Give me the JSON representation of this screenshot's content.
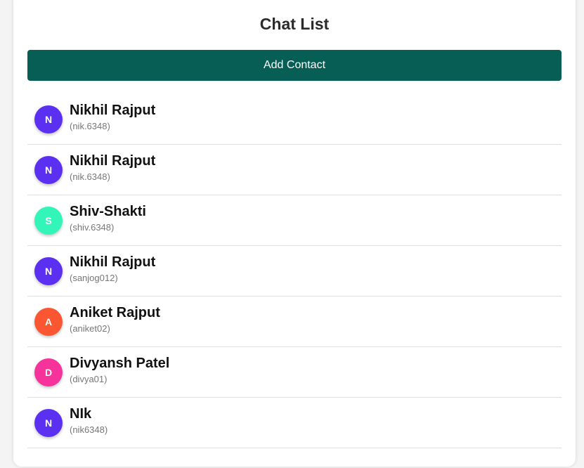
{
  "header": {
    "title": "Chat List"
  },
  "actions": {
    "add_contact_label": "Add Contact",
    "button_color": "#075e54"
  },
  "contacts": [
    {
      "initial": "N",
      "name": "Nikhil Rajput",
      "username": "(nik.6348)",
      "color": "#5b30f0"
    },
    {
      "initial": "N",
      "name": "Nikhil Rajput",
      "username": "(nik.6348)",
      "color": "#5b30f0"
    },
    {
      "initial": "S",
      "name": "Shiv-Shakti",
      "username": "(shiv.6348)",
      "color": "#33f5b9"
    },
    {
      "initial": "N",
      "name": "Nikhil Rajput",
      "username": "(sanjog012)",
      "color": "#5b30f0"
    },
    {
      "initial": "A",
      "name": "Aniket Rajput",
      "username": "(aniket02)",
      "color": "#fb5632"
    },
    {
      "initial": "D",
      "name": "Divyansh Patel",
      "username": "(divya01)",
      "color": "#f5339a"
    },
    {
      "initial": "N",
      "name": "NIk",
      "username": "(nik6348)",
      "color": "#5b30f0"
    }
  ]
}
